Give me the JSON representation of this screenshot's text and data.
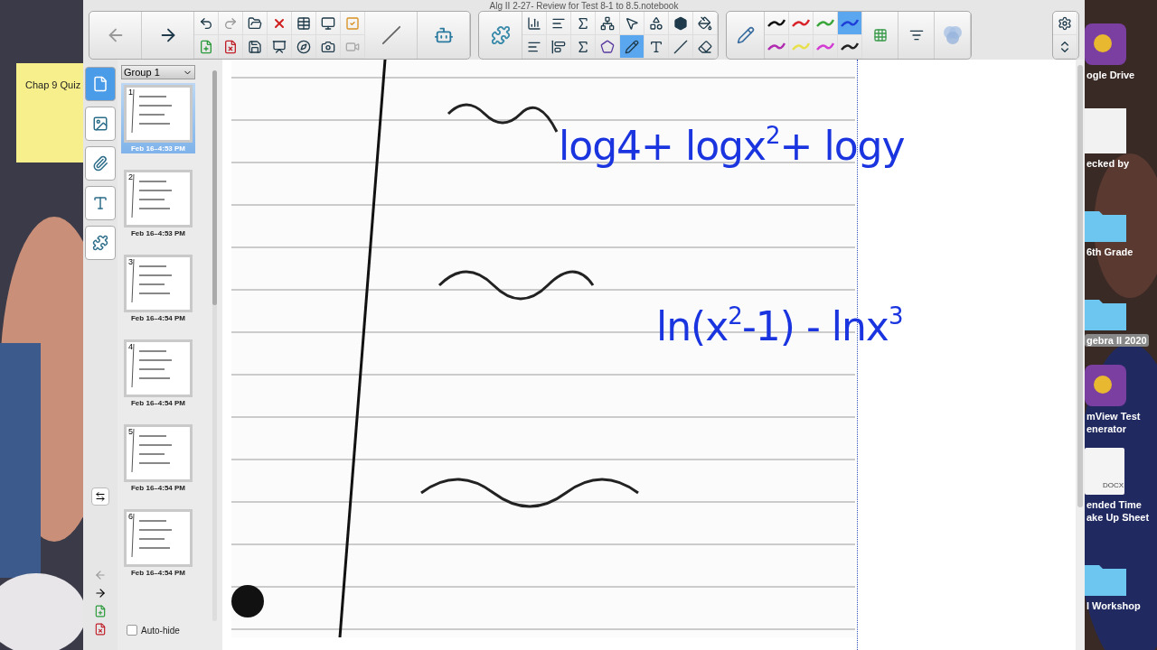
{
  "window": {
    "title": "Alg II 2-27- Review for Test 8-1 to 8.5.notebook"
  },
  "toolbar": {
    "modes": [
      {
        "kind": "select",
        "selected": false
      },
      {
        "kind": "pens",
        "selected": true
      }
    ],
    "pen_colors": [
      {
        "color": "#111111",
        "selected": false
      },
      {
        "color": "#d8252b",
        "selected": false
      },
      {
        "color": "#3aa63a",
        "selected": false
      },
      {
        "color": "#1f3fd8",
        "selected": true
      },
      {
        "color": "#b02bb0",
        "selected": false
      },
      {
        "color": "#e8e04a",
        "selected": false
      },
      {
        "color": "#d43bd4",
        "selected": false
      },
      {
        "color": "#222222",
        "selected": false
      }
    ]
  },
  "side_tabs": [
    {
      "kind": "pages",
      "selected": true
    },
    {
      "kind": "gallery",
      "selected": false
    },
    {
      "kind": "attachments",
      "selected": false
    },
    {
      "kind": "properties",
      "selected": false
    },
    {
      "kind": "addons",
      "selected": false
    }
  ],
  "page_sorter": {
    "group": "Group 1",
    "pages": [
      {
        "number": "1",
        "date": "Feb 16–4:53 PM",
        "selected": true
      },
      {
        "number": "2",
        "date": "Feb 16–4:53 PM",
        "selected": false
      },
      {
        "number": "3",
        "date": "Feb 16–4:54 PM",
        "selected": false
      },
      {
        "number": "4",
        "date": "Feb 16–4:54 PM",
        "selected": false
      },
      {
        "number": "5",
        "date": "Feb 16–4:54 PM",
        "selected": false
      },
      {
        "number": "6",
        "date": "Feb 16–4:54 PM",
        "selected": false
      }
    ],
    "auto_hide": {
      "label": "Auto-hide",
      "checked": false
    }
  },
  "ink": [
    "log4+ logx$^{2}$+ logy",
    "ln(x$^{2}$-1) - lnx$^{3}$"
  ],
  "desktop": {
    "sticky_note": "Chap 9 Quiz",
    "items": [
      {
        "kind": "app",
        "label": "ogle Drive",
        "selected": false
      },
      {
        "kind": "file",
        "label": "ecked by",
        "selected": false
      },
      {
        "kind": "folder",
        "label": "6th Grade",
        "selected": false
      },
      {
        "kind": "folder",
        "label": "gebra II 2020",
        "selected": true
      },
      {
        "kind": "app",
        "label": "mView Test enerator",
        "selected": false
      },
      {
        "kind": "doc",
        "badge": "DOCX",
        "label": "ended Time ake Up Sheet",
        "selected": false
      },
      {
        "kind": "folder",
        "label": "l Workshop",
        "selected": false
      }
    ]
  }
}
